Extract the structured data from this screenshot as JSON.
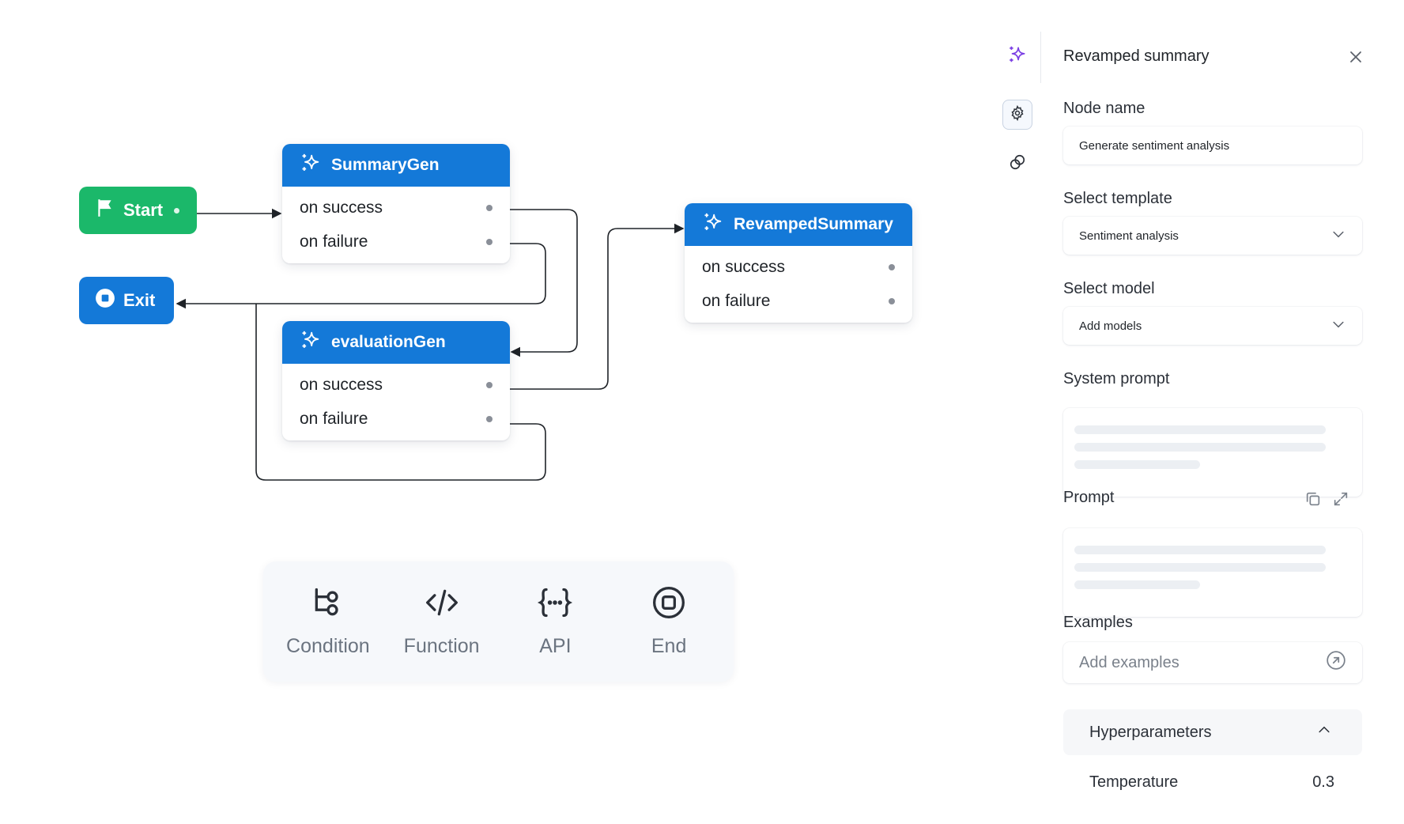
{
  "canvas": {
    "start": {
      "label": "Start"
    },
    "exit": {
      "label": "Exit"
    },
    "nodes": {
      "summary": {
        "title": "SummaryGen",
        "success": "on success",
        "failure": "on failure"
      },
      "eval": {
        "title": "evaluationGen",
        "success": "on success",
        "failure": "on failure"
      },
      "revamp": {
        "title": "RevampedSummary",
        "success": "on success",
        "failure": "on failure"
      }
    },
    "palette": [
      {
        "label": "Condition",
        "icon": "condition-icon"
      },
      {
        "label": "Function",
        "icon": "code-icon"
      },
      {
        "label": "API",
        "icon": "api-braces-icon"
      },
      {
        "label": "End",
        "icon": "stop-circle-icon"
      }
    ]
  },
  "panel": {
    "title": "Revamped summary",
    "node_name": {
      "label": "Node name",
      "value": "Generate sentiment analysis"
    },
    "template": {
      "label": "Select template",
      "value": "Sentiment analysis"
    },
    "model": {
      "label": "Select model",
      "value": "Add models"
    },
    "system_prompt": {
      "label": "System prompt"
    },
    "prompt": {
      "label": "Prompt"
    },
    "examples": {
      "label": "Examples",
      "placeholder": "Add examples"
    },
    "hyperparameters": {
      "label": "Hyperparameters",
      "temperature_label": "Temperature",
      "temperature_value": "0.3"
    }
  },
  "colors": {
    "node_header": "#1479d8",
    "start": "#1bb86a",
    "exit": "#1479d8",
    "ai_accent": "#7b3fe4"
  }
}
